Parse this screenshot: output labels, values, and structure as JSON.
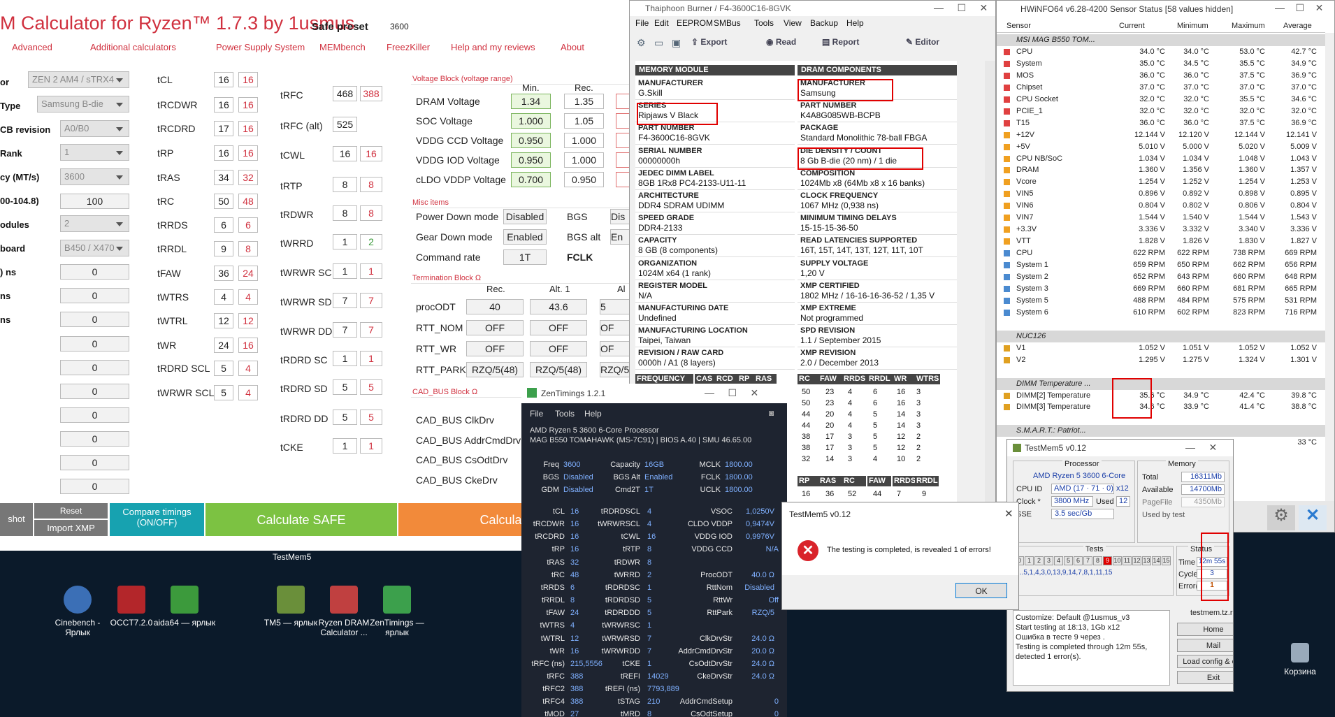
{
  "drc": {
    "title": "M Calculator for Ryzen™ 1.7.3 by 1usmus",
    "safe_preset_label": "Safe preset",
    "safe_preset_value": "3600",
    "menu": [
      "Advanced",
      "Additional calculators",
      "Power Supply System",
      "MEMbench",
      "FreezKiller",
      "Help and my reviews",
      "About"
    ],
    "left_labels": [
      "or",
      "Type",
      "CB revision",
      "Rank",
      "cy (MT/s)",
      "00-104.8)",
      "odules",
      "board",
      ") ns",
      "ns",
      "ns"
    ],
    "left_values": [
      "ZEN 2 AM4 / sTRX4",
      "Samsung B-die",
      "A0/B0",
      "1",
      "3600",
      "100",
      "2",
      "B450 / X470",
      "0",
      "0",
      "0",
      "0",
      "0",
      "0",
      "0",
      "0",
      "0",
      "0"
    ],
    "timings_a": [
      [
        "tCL",
        "16",
        "16"
      ],
      [
        "tRCDWR",
        "16",
        "16"
      ],
      [
        "tRCDRD",
        "17",
        "16"
      ],
      [
        "tRP",
        "16",
        "16"
      ],
      [
        "tRAS",
        "34",
        "32"
      ],
      [
        "tRC",
        "50",
        "48"
      ],
      [
        "tRRDS",
        "6",
        "6"
      ],
      [
        "tRRDL",
        "9",
        "8"
      ],
      [
        "tFAW",
        "36",
        "24"
      ],
      [
        "tWTRS",
        "4",
        "4"
      ],
      [
        "tWTRL",
        "12",
        "12"
      ],
      [
        "tWR",
        "24",
        "16"
      ],
      [
        "tRDRD SCL",
        "5",
        "4"
      ],
      [
        "tWRWR SCL",
        "5",
        "4"
      ]
    ],
    "timings_b": [
      [
        "tRFC",
        "468",
        "388"
      ],
      [
        "tRFC (alt)",
        "525",
        ""
      ],
      [
        "tCWL",
        "16",
        "16"
      ],
      [
        "tRTP",
        "8",
        "8"
      ],
      [
        "tRDWR",
        "8",
        "8"
      ],
      [
        "tWRRD",
        "1",
        "2"
      ],
      [
        "tWRWR SC",
        "1",
        "1"
      ],
      [
        "tWRWR SD",
        "7",
        "7"
      ],
      [
        "tWRWR DD",
        "7",
        "7"
      ],
      [
        "tRDRD SC",
        "1",
        "1"
      ],
      [
        "tRDRD SD",
        "5",
        "5"
      ],
      [
        "tRDRD DD",
        "5",
        "5"
      ],
      [
        "tCKE",
        "1",
        "1"
      ]
    ],
    "voltage_block": "Voltage Block (voltage range)",
    "vb_headers": [
      "Min.",
      "Rec."
    ],
    "voltages": [
      [
        "DRAM Voltage",
        "1.34",
        "1.35"
      ],
      [
        "SOC Voltage",
        "1.000",
        "1.05"
      ],
      [
        "VDDG  CCD Voltage",
        "0.950",
        "1.000"
      ],
      [
        "VDDG  IOD Voltage",
        "0.950",
        "1.000"
      ],
      [
        "cLDO VDDP Voltage",
        "0.700",
        "0.950"
      ]
    ],
    "misc": "Misc items",
    "misc_items": [
      [
        "Power Down mode",
        "Disabled",
        "BGS",
        "Dis"
      ],
      [
        "Gear Down mode",
        "Enabled",
        "BGS alt",
        "En"
      ],
      [
        "Command rate",
        "1T",
        "FCLK",
        ""
      ]
    ],
    "term": "Termination Block Ω",
    "term_headers": [
      "Rec.",
      "Alt. 1",
      "Al"
    ],
    "term_items": [
      [
        "procODT",
        "40",
        "43.6",
        "5"
      ],
      [
        "RTT_NOM",
        "OFF",
        "OFF",
        "OF"
      ],
      [
        "RTT_WR",
        "OFF",
        "OFF",
        "OF"
      ],
      [
        "RTT_PARK",
        "RZQ/5(48)",
        "RZQ/5(48)",
        "RZQ/5"
      ]
    ],
    "cad": "CAD_BUS Block Ω",
    "cad_items": [
      "CAD_BUS ClkDrv",
      "CAD_BUS AddrCmdDrv",
      "CAD_BUS CsOdtDrv",
      "CAD_BUS CkeDrv"
    ],
    "btn_shot": "shot",
    "btn_reset": "Reset",
    "btn_import": "Import XMP",
    "btn_compare": "Compare timings (ON/OFF)",
    "btn_safe": "Calculate SAFE",
    "btn_fast": "Calculate FA"
  },
  "taskbar_label": "TestMem5",
  "desktop": [
    {
      "label": "Cinebench - Ярлык",
      "color": "#3b6fb6"
    },
    {
      "label": "OCCT7.2.0",
      "color": "#b3262a"
    },
    {
      "label": "aida64 — ярлык",
      "color": "#3c9a3c"
    },
    {
      "label": "TM5 — ярлык",
      "color": "#6a8f3a"
    },
    {
      "label": "Ryzen DRAM Calculator ...",
      "color": "#c04040"
    },
    {
      "label": "ZenTimings — ярлык",
      "color": "#3ca04c"
    },
    {
      "label": "Корзина",
      "color": "#9ab"
    }
  ],
  "thai": {
    "title": "Thaiphoon Burner / F4-3600C16-8GVK",
    "menu": [
      "File",
      "Edit",
      "EEPROM",
      "SMBus",
      "Tools",
      "View",
      "Backup",
      "Help"
    ],
    "toolbar": [
      "Export",
      "Read",
      "Report",
      "Editor"
    ],
    "col1_head": "MEMORY MODULE",
    "col2_head": "DRAM COMPONENTS",
    "col1": [
      [
        "MANUFACTURER",
        "G.Skill"
      ],
      [
        "SERIES",
        "Ripjaws V Black"
      ],
      [
        "PART NUMBER",
        "F4-3600C16-8GVK"
      ],
      [
        "SERIAL NUMBER",
        "00000000h"
      ],
      [
        "JEDEC DIMM LABEL",
        "8GB 1Rx8 PC4-2133-U11-11"
      ],
      [
        "ARCHITECTURE",
        "DDR4 SDRAM UDIMM"
      ],
      [
        "SPEED GRADE",
        "DDR4-2133"
      ],
      [
        "CAPACITY",
        "8 GB (8 components)"
      ],
      [
        "ORGANIZATION",
        "1024M x64 (1 rank)"
      ],
      [
        "REGISTER MODEL",
        "N/A"
      ],
      [
        "MANUFACTURING DATE",
        "Undefined"
      ],
      [
        "MANUFACTURING LOCATION",
        "Taipei, Taiwan"
      ],
      [
        "REVISION / RAW CARD",
        "0000h / A1 (8 layers)"
      ]
    ],
    "col2": [
      [
        "MANUFACTURER",
        "Samsung"
      ],
      [
        "PART NUMBER",
        "K4A8G085WB-BCPB"
      ],
      [
        "PACKAGE",
        "Standard Monolithic 78-ball FBGA"
      ],
      [
        "DIE DENSITY / COUNT",
        "8 Gb B-die (20 nm) / 1 die"
      ],
      [
        "COMPOSITION",
        "1024Mb x8 (64Mb x8 x 16 banks)"
      ],
      [
        "CLOCK FREQUENCY",
        "1067 MHz (0,938 ns)"
      ],
      [
        "MINIMUM TIMING DELAYS",
        "15-15-15-36-50"
      ],
      [
        "READ LATENCIES SUPPORTED",
        "16T, 15T, 14T, 13T, 12T, 11T, 10T"
      ],
      [
        "SUPPLY VOLTAGE",
        "1,20 V"
      ],
      [
        "XMP CERTIFIED",
        "1802 MHz / 16-16-16-36-52 / 1,35 V"
      ],
      [
        "XMP EXTREME",
        "Not programmed"
      ],
      [
        "SPD REVISION",
        "1.1 / September 2015"
      ],
      [
        "XMP REVISION",
        "2.0 / December 2013"
      ]
    ],
    "freq_head": [
      "FREQUENCY",
      "CAS",
      "RCD",
      "RP",
      "RAS",
      "RC",
      "FAW",
      "RRDS",
      "RRDL",
      "WR",
      "WTRS"
    ],
    "freq_rows": [
      [
        "50",
        "23",
        "4",
        "6",
        "16",
        "3"
      ],
      [
        "50",
        "23",
        "4",
        "6",
        "16",
        "3"
      ],
      [
        "44",
        "20",
        "4",
        "5",
        "14",
        "3"
      ],
      [
        "44",
        "20",
        "4",
        "5",
        "14",
        "3"
      ],
      [
        "38",
        "17",
        "3",
        "5",
        "12",
        "2"
      ],
      [
        "38",
        "17",
        "3",
        "5",
        "12",
        "2"
      ],
      [
        "32",
        "14",
        "3",
        "4",
        "10",
        "2"
      ]
    ],
    "freq_head2": [
      "RP",
      "RAS",
      "RC",
      "FAW",
      "RRDS",
      "RRDL"
    ],
    "freq_row2": [
      "16",
      "36",
      "52",
      "44",
      "7",
      "9"
    ]
  },
  "hw": {
    "title": "HWiNFO64 v6.28-4200 Sensor Status [58 values hidden]",
    "headers": [
      "Sensor",
      "Current",
      "Minimum",
      "Maximum",
      "Average"
    ],
    "rows": [
      [
        "MSI MAG B550 TOM...",
        "",
        "",
        "",
        ""
      ],
      [
        "CPU",
        "34.0 °C",
        "34.0 °C",
        "53.0 °C",
        "42.7 °C"
      ],
      [
        "System",
        "35.0 °C",
        "34.5 °C",
        "35.5 °C",
        "34.9 °C"
      ],
      [
        "MOS",
        "36.0 °C",
        "36.0 °C",
        "37.5 °C",
        "36.9 °C"
      ],
      [
        "Chipset",
        "37.0 °C",
        "37.0 °C",
        "37.0 °C",
        "37.0 °C"
      ],
      [
        "CPU Socket",
        "32.0 °C",
        "32.0 °C",
        "35.5 °C",
        "34.6 °C"
      ],
      [
        "PCIE_1",
        "32.0 °C",
        "32.0 °C",
        "32.0 °C",
        "32.0 °C"
      ],
      [
        "T15",
        "36.0 °C",
        "36.0 °C",
        "37.5 °C",
        "36.9 °C"
      ],
      [
        "+12V",
        "12.144 V",
        "12.120 V",
        "12.144 V",
        "12.141 V"
      ],
      [
        "+5V",
        "5.010 V",
        "5.000 V",
        "5.020 V",
        "5.009 V"
      ],
      [
        "CPU NB/SoC",
        "1.034 V",
        "1.034 V",
        "1.048 V",
        "1.043 V"
      ],
      [
        "DRAM",
        "1.360 V",
        "1.356 V",
        "1.360 V",
        "1.357 V"
      ],
      [
        "Vcore",
        "1.254 V",
        "1.252 V",
        "1.254 V",
        "1.253 V"
      ],
      [
        "VIN5",
        "0.896 V",
        "0.892 V",
        "0.898 V",
        "0.895 V"
      ],
      [
        "VIN6",
        "0.804 V",
        "0.802 V",
        "0.806 V",
        "0.804 V"
      ],
      [
        "VIN7",
        "1.544 V",
        "1.540 V",
        "1.544 V",
        "1.543 V"
      ],
      [
        "+3.3V",
        "3.336 V",
        "3.332 V",
        "3.340 V",
        "3.336 V"
      ],
      [
        "VTT",
        "1.828 V",
        "1.826 V",
        "1.830 V",
        "1.827 V"
      ],
      [
        "CPU",
        "622 RPM",
        "622 RPM",
        "738 RPM",
        "669 RPM"
      ],
      [
        "System 1",
        "659 RPM",
        "650 RPM",
        "662 RPM",
        "656 RPM"
      ],
      [
        "System 2",
        "652 RPM",
        "643 RPM",
        "660 RPM",
        "648 RPM"
      ],
      [
        "System 3",
        "669 RPM",
        "660 RPM",
        "681 RPM",
        "665 RPM"
      ],
      [
        "System 5",
        "488 RPM",
        "484 RPM",
        "575 RPM",
        "531 RPM"
      ],
      [
        "System 6",
        "610 RPM",
        "602 RPM",
        "823 RPM",
        "716 RPM"
      ],
      [
        "",
        "",
        "",
        "",
        ""
      ],
      [
        "NUC126",
        "",
        "",
        "",
        ""
      ],
      [
        "V1",
        "1.052 V",
        "1.051 V",
        "1.052 V",
        "1.052 V"
      ],
      [
        "V2",
        "1.295 V",
        "1.275 V",
        "1.324 V",
        "1.301 V"
      ],
      [
        "",
        "",
        "",
        "",
        ""
      ],
      [
        "DIMM Temperature ...",
        "",
        "",
        "",
        ""
      ],
      [
        "DIMM[2] Temperature",
        "35.6 °C",
        "34.9 °C",
        "42.4 °C",
        "39.8 °C"
      ],
      [
        "DIMM[3] Temperature",
        "34.6 °C",
        "33.9 °C",
        "41.4 °C",
        "38.8 °C"
      ],
      [
        "",
        "",
        "",
        "",
        ""
      ],
      [
        "S.M.A.R.T.: Patriot...",
        "",
        "",
        "",
        ""
      ],
      [
        "",
        "",
        "",
        "",
        "33 °C"
      ]
    ]
  },
  "zen": {
    "title": "ZenTimings 1.2.1",
    "menu": [
      "File",
      "Tools",
      "Help"
    ],
    "cpu": "AMD Ryzen 5 3600 6-Core Processor",
    "board": "MAG B550 TOMAHAWK (MS-7C91) | BIOS A.40 | SMU 46.65.00",
    "top": [
      [
        "Freq",
        "3600",
        "Capacity",
        "16GB",
        "MCLK",
        "1800.00"
      ],
      [
        "BGS",
        "Disabled",
        "BGS Alt",
        "Enabled",
        "FCLK",
        "1800.00"
      ],
      [
        "GDM",
        "Disabled",
        "Cmd2T",
        "1T",
        "UCLK",
        "1800.00"
      ]
    ],
    "rows": [
      [
        "tCL",
        "16",
        "tRDRDSCL",
        "4",
        "VSOC",
        "1,0250V"
      ],
      [
        "tRCDWR",
        "16",
        "tWRWRSCL",
        "4",
        "CLDO VDDP",
        "0,9474V"
      ],
      [
        "tRCDRD",
        "16",
        "tCWL",
        "16",
        "VDDG IOD",
        "0,9976V"
      ],
      [
        "tRP",
        "16",
        "tRTP",
        "8",
        "VDDG CCD",
        "N/A"
      ],
      [
        "tRAS",
        "32",
        "tRDWR",
        "8",
        "",
        ""
      ],
      [
        "tRC",
        "48",
        "tWRRD",
        "2",
        "ProcODT",
        "40.0 Ω"
      ],
      [
        "tRRDS",
        "6",
        "tRDRDSC",
        "1",
        "RttNom",
        "Disabled"
      ],
      [
        "tRRDL",
        "8",
        "tRDRDSD",
        "5",
        "RttWr",
        "Off"
      ],
      [
        "tFAW",
        "24",
        "tRDRDDD",
        "5",
        "RttPark",
        "RZQ/5"
      ],
      [
        "tWTRS",
        "4",
        "tWRWRSC",
        "1",
        "",
        ""
      ],
      [
        "tWTRL",
        "12",
        "tWRWRSD",
        "7",
        "ClkDrvStr",
        "24.0 Ω"
      ],
      [
        "tWR",
        "16",
        "tWRWRDD",
        "7",
        "AddrCmdDrvStr",
        "20.0 Ω"
      ],
      [
        "tRFC (ns)",
        "215,5556",
        "tCKE",
        "1",
        "CsOdtDrvStr",
        "24.0 Ω"
      ],
      [
        "tRFC",
        "388",
        "tREFI",
        "14029",
        "CkeDrvStr",
        "24.0 Ω"
      ],
      [
        "tRFC2",
        "388",
        "tREFI (ns)",
        "7793,889",
        "",
        ""
      ],
      [
        "tRFC4",
        "388",
        "tSTAG",
        "210",
        "AddrCmdSetup",
        "0"
      ],
      [
        "tMOD",
        "27",
        "tMRD",
        "8",
        "CsOdtSetup",
        "0"
      ]
    ]
  },
  "tm": {
    "title": "TestMem5 v0.12",
    "processor_label": "Processor",
    "processor": "AMD Ryzen 5 3600 6-Core",
    "cpuid_label": "CPU ID",
    "cpuid": "AMD  (17 · 71 · 0)",
    "threads": "x12",
    "clock_label": "Clock *",
    "clock": "3800 MHz",
    "used_label": "Used",
    "used": "12",
    "sse_label": "SSE",
    "sse": "3.5 sec/Gb",
    "memory_label": "Memory",
    "total_label": "Total",
    "total": "16311Mb",
    "avail_label": "Available",
    "avail": "14700Mb",
    "page_label": "PageFile",
    "page": "4350Mb",
    "ubt_label": "Used by test",
    "tests_label": "Tests",
    "tests": [
      "0",
      "1",
      "2",
      "3",
      "4",
      "5",
      "6",
      "7",
      "8",
      "9",
      "10",
      "11",
      "12",
      "13",
      "14",
      "15"
    ],
    "seq": "...5,1,4,3,0,13,9,14,7,8,1,11,15",
    "status_label": "Status",
    "time_label": "Time",
    "time": "12m 55s",
    "cycle_label": "Cycle",
    "cycle": "3",
    "err_label": "Error(s)",
    "err": "1",
    "log": [
      "Customize: Default @1usmus_v3",
      "Start testing at 18:13, 1Gb x12",
      "Ошибка в тесте 9 через .",
      "Testing is completed through 12m 55s,",
      "detected 1 error(s)."
    ],
    "site": "testmem.tz.ru",
    "buttons": [
      "Home",
      "Mail",
      "Load config & exit",
      "Exit"
    ]
  },
  "dlg": {
    "title": "TestMem5 v0.12",
    "message": "The testing is completed, is revealed 1 of errors!",
    "ok": "OK"
  }
}
